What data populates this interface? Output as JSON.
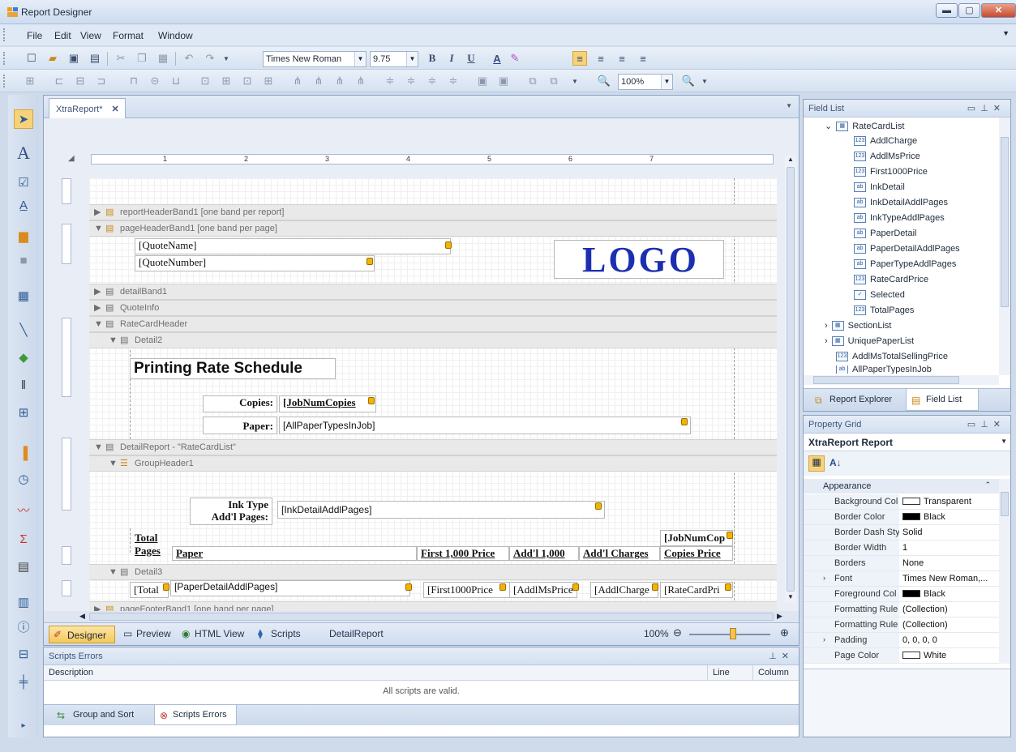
{
  "window": {
    "title": "Report Designer",
    "min": "▬",
    "max": "▢",
    "close": "✕"
  },
  "menu": [
    "File",
    "Edit",
    "View",
    "Format",
    "Window"
  ],
  "toolbar": {
    "font_name": "Times New Roman",
    "font_size": "9.75",
    "bold": "B",
    "italic": "I",
    "underline": "U",
    "zoom": "100%"
  },
  "doc_tab": {
    "label": "XtraReport*",
    "close": "✕"
  },
  "ruler_labels": [
    "1",
    "2",
    "3",
    "4",
    "5",
    "6",
    "7"
  ],
  "bands": {
    "report_header": "reportHeaderBand1 [one band per report]",
    "page_header": "pageHeaderBand1 [one band per page]",
    "detail_band": "detailBand1",
    "quote_info": "QuoteInfo",
    "rate_card_header": "RateCardHeader",
    "detail2": "Detail2",
    "detail_report": "DetailReport - \"RateCardList\"",
    "group_header": "GroupHeader1",
    "detail3": "Detail3",
    "page_footer": "pageFooterBand1 [one band per page]"
  },
  "controls": {
    "quote_name": "[QuoteName]",
    "quote_number": "[QuoteNumber]",
    "logo": "LOGO",
    "schedule_title": "Printing Rate Schedule",
    "copies_label": "Copies:",
    "copies_value": "[JobNumCopies",
    "paper_label": "Paper:",
    "paper_value": "[AllPaperTypesInJob]",
    "ink_label_1": "Ink Type",
    "ink_label_2": "Add'l Pages:",
    "ink_value": "[InkDetailAddlPages]",
    "total_pages_1": "Total",
    "total_pages_2": "Pages",
    "paper_col": "Paper",
    "first1000_col": "First 1,000 Price",
    "addl1000_col": "Add'l 1,000",
    "addlcharges_col": "Add'l Charges",
    "jobnumcop": "[JobNumCop",
    "copies_price": "Copies Price",
    "d3_total": "[Total",
    "d3_paper": "[PaperDetailAddlPages]",
    "d3_first": "[First1000Price",
    "d3_addlms": "[AddlMsPrice",
    "d3_charge": "[AddlCharge",
    "d3_rate": "[RateCardPri"
  },
  "bottom_tabs": {
    "designer": "Designer",
    "preview": "Preview",
    "html_view": "HTML View",
    "scripts": "Scripts",
    "detail_report": "DetailReport",
    "zoom": "100%"
  },
  "scripts_errors": {
    "title": "Scripts Errors",
    "col_description": "Description",
    "col_line": "Line",
    "col_column": "Column",
    "message": "All scripts are valid."
  },
  "lower_tabs": {
    "group_sort": "Group and Sort",
    "scripts_errors": "Scripts Errors"
  },
  "field_list": {
    "title": "Field List",
    "root": "RateCardList",
    "fields": [
      {
        "name": "AddlCharge",
        "type": "123"
      },
      {
        "name": "AddlMsPrice",
        "type": "123"
      },
      {
        "name": "First1000Price",
        "type": "123"
      },
      {
        "name": "InkDetail",
        "type": "ab"
      },
      {
        "name": "InkDetailAddlPages",
        "type": "ab"
      },
      {
        "name": "InkTypeAddlPages",
        "type": "ab"
      },
      {
        "name": "PaperDetail",
        "type": "ab"
      },
      {
        "name": "PaperDetailAddlPages",
        "type": "ab"
      },
      {
        "name": "PaperTypeAddlPages",
        "type": "ab"
      },
      {
        "name": "RateCardPrice",
        "type": "123"
      },
      {
        "name": "Selected",
        "type": "✓"
      },
      {
        "name": "TotalPages",
        "type": "123"
      }
    ],
    "others": [
      "SectionList",
      "UniquePaperList",
      "AddlMsTotalSellingPrice",
      "AllPaperTypesInJob"
    ],
    "tab_report_explorer": "Report Explorer",
    "tab_field_list": "Field List"
  },
  "property_grid": {
    "title": "Property Grid",
    "object": "XtraReport  Report",
    "category": "Appearance",
    "rows": [
      {
        "k": "Background Col",
        "v": "Transparent",
        "swatch": "#ffffff"
      },
      {
        "k": "Border Color",
        "v": "Black",
        "swatch": "#000000"
      },
      {
        "k": "Border Dash Sty",
        "v": "Solid"
      },
      {
        "k": "Border Width",
        "v": "1"
      },
      {
        "k": "Borders",
        "v": "None"
      },
      {
        "k": "Font",
        "v": "Times New Roman,..."
      },
      {
        "k": "Foreground Col",
        "v": "Black",
        "swatch": "#000000"
      },
      {
        "k": "Formatting Rule",
        "v": "(Collection)"
      },
      {
        "k": "Formatting Rule",
        "v": "(Collection)"
      },
      {
        "k": "Padding",
        "v": "0, 0, 0, 0"
      },
      {
        "k": "Page Color",
        "v": "White",
        "swatch": "#ffffff"
      }
    ]
  }
}
